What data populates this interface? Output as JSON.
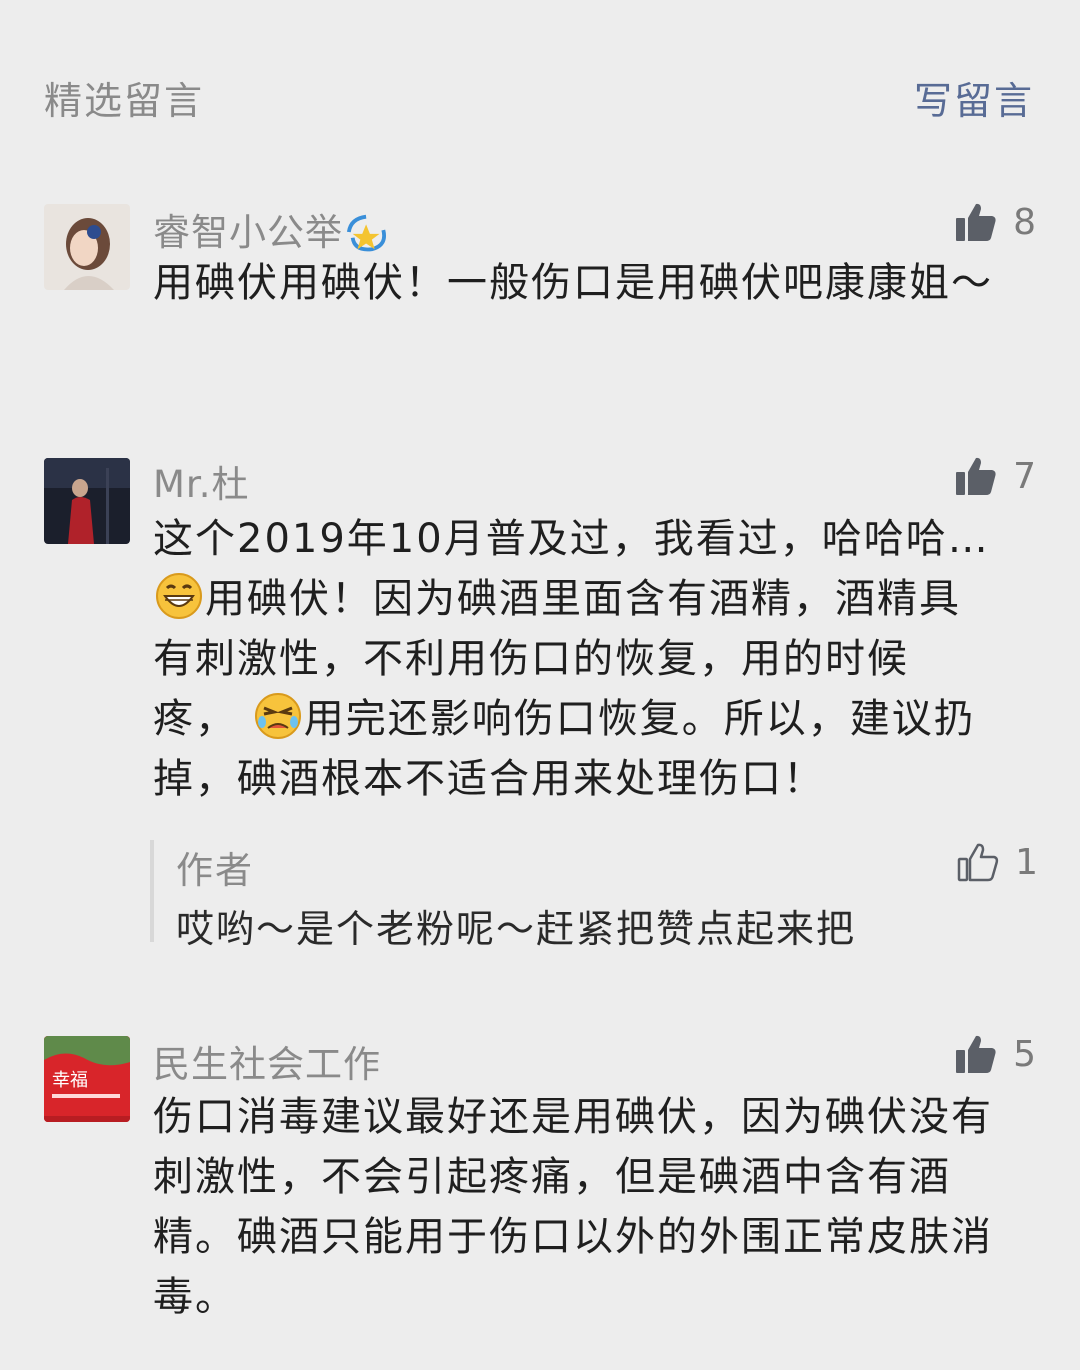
{
  "header": {
    "title": "精选留言",
    "write_label": "写留言"
  },
  "comments": [
    {
      "nickname": "睿智小公举",
      "likes": "8",
      "text": "用碘伏用碘伏！一般伤口是用碘伏吧康康姐～"
    },
    {
      "nickname": "Mr.杜",
      "likes": "7",
      "lines": [
        "这个2019年10月普及过，我看过，哈哈哈…",
        "用碘伏！因为碘酒里面含有酒精，酒精具",
        "有刺激性，不利用伤口的恢复，用的时候",
        "疼，",
        "用完还影响伤口恢复。所以，建议扔",
        "掉，碘酒根本不适合用来处理伤口！"
      ],
      "reply": {
        "author": "作者",
        "likes": "1",
        "text": "哎哟～是个老粉呢～赶紧把赞点起来把"
      }
    },
    {
      "nickname": "民生社会工作",
      "likes": "5",
      "avatar_text": "幸福",
      "text": "伤口消毒建议最好还是用碘伏，因为碘伏没有刺激性，不会引起疼痛，但是碘酒中含有酒精。碘酒只能用于伤口以外的外围正常皮肤消毒。"
    }
  ],
  "icons": {
    "like_filled": "thumbs-up-filled-icon",
    "like_outline": "thumbs-up-outline-icon",
    "emoji_grin": "grinning-emoji-icon",
    "emoji_cry": "crying-emoji-icon",
    "emoji_sparkle": "dizzy-star-emoji-icon"
  },
  "colors": {
    "link": "#586b95",
    "meta": "#8a8a8a",
    "background": "#ededed"
  }
}
